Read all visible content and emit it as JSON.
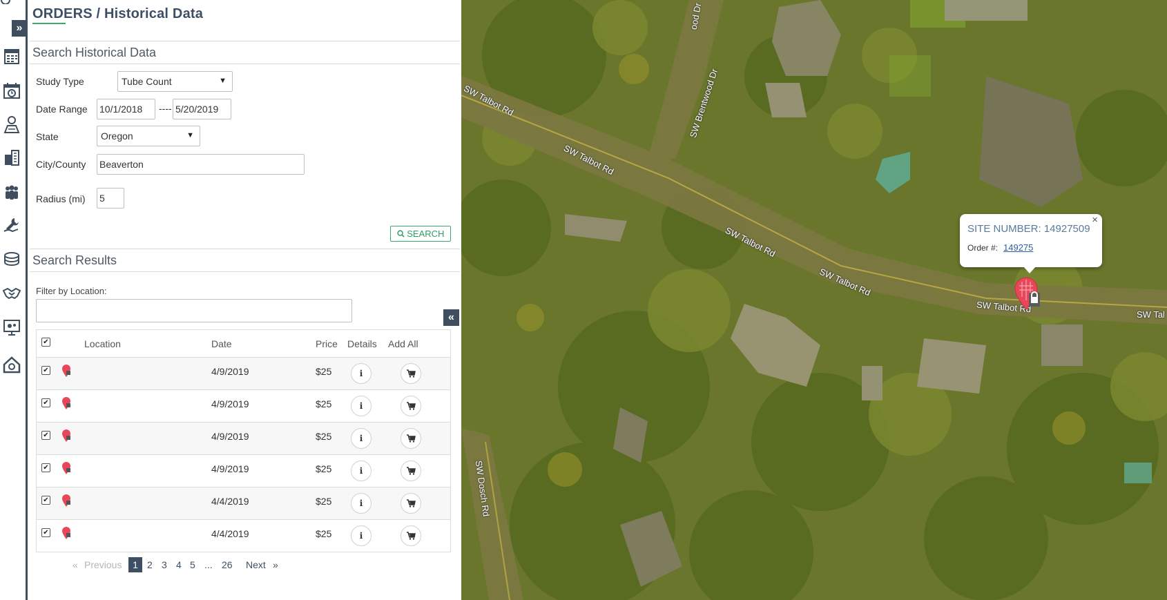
{
  "header": {
    "title": "ORDERS / Historical Data"
  },
  "rail": {
    "icons": [
      "expand-icon",
      "invoice-icon",
      "calendar-history-icon",
      "user-map-icon",
      "buildings-icon",
      "people-icon",
      "wrench-hand-icon",
      "coins-icon",
      "handshake-icon",
      "monitor-settings-icon",
      "house-search-icon"
    ]
  },
  "search": {
    "section_title": "Search Historical Data",
    "study_type_label": "Study Type",
    "study_type_value": "Tube Count",
    "date_range_label": "Date Range",
    "date_from": "10/1/2018",
    "date_separator": "----",
    "date_to": "5/20/2019",
    "state_label": "State",
    "state_value": "Oregon",
    "city_label": "City/County",
    "city_value": "Beaverton",
    "radius_label": "Radius (mi)",
    "radius_value": "5",
    "search_button": "SEARCH"
  },
  "results": {
    "section_title": "Search Results",
    "filter_label": "Filter by Location:",
    "filter_value": "",
    "columns": {
      "location": "Location",
      "date": "Date",
      "price": "Price",
      "details": "Details",
      "add_all": "Add All"
    },
    "rows": [
      {
        "date": "4/9/2019",
        "price": "$25",
        "checked": true
      },
      {
        "date": "4/9/2019",
        "price": "$25",
        "checked": true
      },
      {
        "date": "4/9/2019",
        "price": "$25",
        "checked": true
      },
      {
        "date": "4/9/2019",
        "price": "$25",
        "checked": true
      },
      {
        "date": "4/4/2019",
        "price": "$25",
        "checked": true
      },
      {
        "date": "4/4/2019",
        "price": "$25",
        "checked": true
      }
    ]
  },
  "pagination": {
    "prev_arrow": "«",
    "previous": "Previous",
    "pages": [
      "1",
      "2",
      "3",
      "4",
      "5"
    ],
    "ellipsis": "...",
    "last": "26",
    "next": "Next",
    "next_arrow": "»",
    "current": "1"
  },
  "map": {
    "road_labels": [
      "SW Talbot Rd",
      "SW Talbot Rd",
      "SW Talbot Rd",
      "SW Talbot Rd",
      "SW Talbot Rd",
      "SW Tal",
      "SW Brentwood Dr",
      "ood Dr",
      "SW Dosch Rd"
    ],
    "popup": {
      "site_number": "SITE NUMBER: 14927509",
      "order_label": "Order #:",
      "order_link": "149275",
      "close": "×"
    },
    "accent_colors": {
      "marker": "#e8475a",
      "nav": "#3c4f65",
      "button_green": "#3aaa6a"
    }
  }
}
